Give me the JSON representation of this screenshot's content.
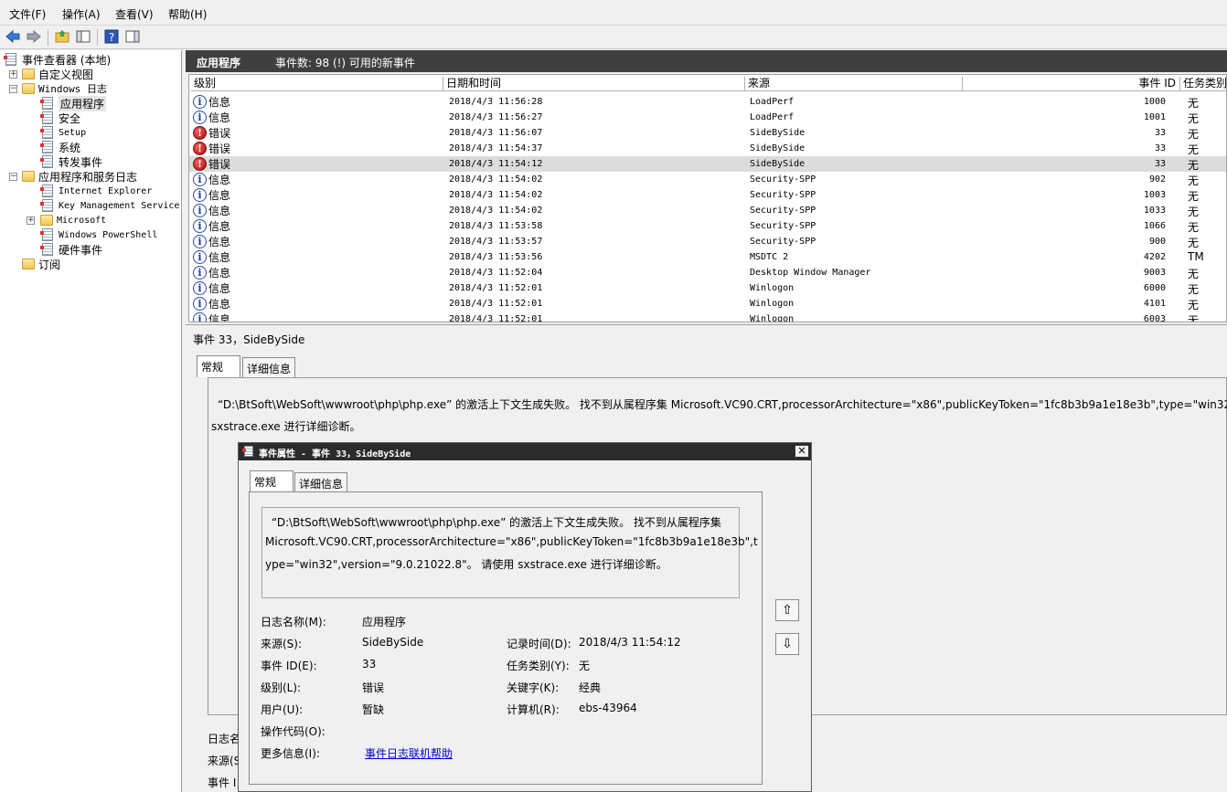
{
  "menu": [
    "文件(F)",
    "操作(A)",
    "查看(V)",
    "帮助(H)"
  ],
  "tree": {
    "root": "事件查看器 (本地)",
    "custom_views": "自定义视图",
    "windows_logs": "Windows 日志",
    "application": "应用程序",
    "security": "安全",
    "setup": "Setup",
    "system": "系统",
    "forwarded": "转发事件",
    "app_service_logs": "应用程序和服务日志",
    "ie": "Internet Explorer",
    "kms": "Key Management Service",
    "microsoft": "Microsoft",
    "powershell": "Windows PowerShell",
    "hardware": "硬件事件",
    "subscriptions": "订阅"
  },
  "pane": {
    "title": "应用程序",
    "count": "事件数: 98 (!) 可用的新事件"
  },
  "columns": {
    "level": "级别",
    "datetime": "日期和时间",
    "source": "来源",
    "event_id": "事件 ID",
    "task": "任务类别"
  },
  "events": [
    {
      "level": "信息",
      "type": "info",
      "datetime": "2018/4/3 11:56:28",
      "source": "LoadPerf",
      "id": "1000",
      "task": "无"
    },
    {
      "level": "信息",
      "type": "info",
      "datetime": "2018/4/3 11:56:27",
      "source": "LoadPerf",
      "id": "1001",
      "task": "无"
    },
    {
      "level": "错误",
      "type": "err",
      "datetime": "2018/4/3 11:56:07",
      "source": "SideBySide",
      "id": "33",
      "task": "无"
    },
    {
      "level": "错误",
      "type": "err",
      "datetime": "2018/4/3 11:54:37",
      "source": "SideBySide",
      "id": "33",
      "task": "无"
    },
    {
      "level": "错误",
      "type": "err",
      "datetime": "2018/4/3 11:54:12",
      "source": "SideBySide",
      "id": "33",
      "task": "无",
      "selected": true
    },
    {
      "level": "信息",
      "type": "info",
      "datetime": "2018/4/3 11:54:02",
      "source": "Security-SPP",
      "id": "902",
      "task": "无"
    },
    {
      "level": "信息",
      "type": "info",
      "datetime": "2018/4/3 11:54:02",
      "source": "Security-SPP",
      "id": "1003",
      "task": "无"
    },
    {
      "level": "信息",
      "type": "info",
      "datetime": "2018/4/3 11:54:02",
      "source": "Security-SPP",
      "id": "1033",
      "task": "无"
    },
    {
      "level": "信息",
      "type": "info",
      "datetime": "2018/4/3 11:53:58",
      "source": "Security-SPP",
      "id": "1066",
      "task": "无"
    },
    {
      "level": "信息",
      "type": "info",
      "datetime": "2018/4/3 11:53:57",
      "source": "Security-SPP",
      "id": "900",
      "task": "无"
    },
    {
      "level": "信息",
      "type": "info",
      "datetime": "2018/4/3 11:53:56",
      "source": "MSDTC 2",
      "id": "4202",
      "task": "TM"
    },
    {
      "level": "信息",
      "type": "info",
      "datetime": "2018/4/3 11:52:04",
      "source": "Desktop Window Manager",
      "id": "9003",
      "task": "无"
    },
    {
      "level": "信息",
      "type": "info",
      "datetime": "2018/4/3 11:52:01",
      "source": "Winlogon",
      "id": "6000",
      "task": "无"
    },
    {
      "level": "信息",
      "type": "info",
      "datetime": "2018/4/3 11:52:01",
      "source": "Winlogon",
      "id": "4101",
      "task": "无"
    },
    {
      "level": "信息",
      "type": "info",
      "datetime": "2018/4/3 11:52:01",
      "source": "Winlogon",
      "id": "6003",
      "task": "无"
    }
  ],
  "detail": {
    "title": "事件 33，SideBySide",
    "tab_general": "常规",
    "tab_details": "详细信息",
    "message_line1": "“D:\\BtSoft\\WebSoft\\wwwroot\\php\\php.exe” 的激活上下文生成失败。 找不到从属程序集 Microsoft.VC90.CRT,processorArchitecture=\"x86\",publicKeyToken=\"1fc8b3b9a1e18e3b\",type=\"win32\",ver",
    "message_line2": "sxstrace.exe 进行详细诊断。",
    "bg_label1": "日志名",
    "bg_label2": "来源(S",
    "bg_label3": "事件 I"
  },
  "modal": {
    "title": "事件属性 - 事件 33，SideBySide",
    "close": "✕",
    "tab_general": "常规",
    "tab_details": "详细信息",
    "msg1": "“D:\\BtSoft\\WebSoft\\wwwroot\\php\\php.exe” 的激活上下文生成失败。 找不到从属程序集",
    "msg2": "Microsoft.VC90.CRT,processorArchitecture=\"x86\",publicKeyToken=\"1fc8b3b9a1e18e3b\",t",
    "msg3": "ype=\"win32\",version=\"9.0.21022.8\"。 请使用 sxstrace.exe 进行详细诊断。",
    "log_name_label": "日志名称(M):",
    "log_name": "应用程序",
    "source_label": "来源(S):",
    "source": "SideBySide",
    "logged_label": "记录时间(D):",
    "logged": "2018/4/3 11:54:12",
    "event_id_label": "事件 ID(E):",
    "event_id": "33",
    "task_label": "任务类别(Y):",
    "task": "无",
    "level_label": "级别(L):",
    "level": "错误",
    "keywords_label": "关键字(K):",
    "keywords": "经典",
    "user_label": "用户(U):",
    "user": "暂缺",
    "computer_label": "计算机(R):",
    "computer": "ebs-43964",
    "opcode_label": "操作代码(O):",
    "more_label": "更多信息(I):",
    "more_link": "事件日志联机帮助",
    "up_arrow": "⇧",
    "down_arrow": "⇩"
  }
}
